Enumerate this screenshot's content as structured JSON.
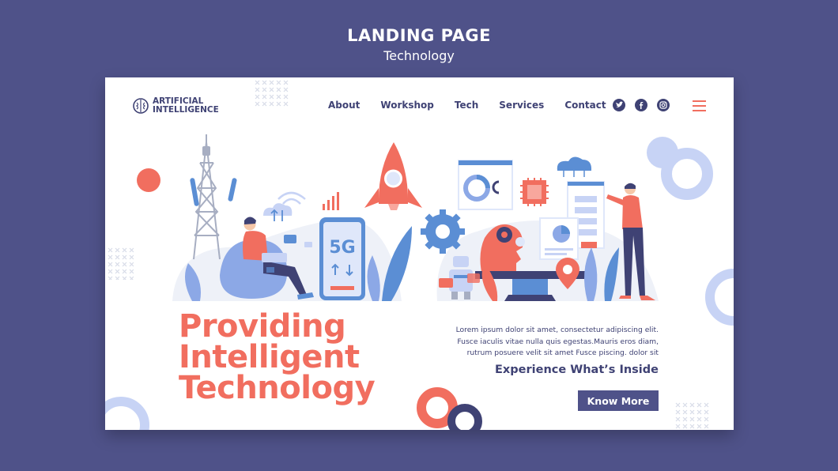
{
  "banner": {
    "title": "LANDING PAGE",
    "subtitle": "Technology"
  },
  "logo": {
    "line1": "ARTIFICIAL",
    "line2": "INTELLIGENCE",
    "icon": "brain-icon"
  },
  "nav": {
    "items": [
      "About",
      "Workshop",
      "Tech",
      "Services",
      "Contact"
    ]
  },
  "social": [
    "twitter-icon",
    "facebook-icon",
    "instagram-icon"
  ],
  "hero": {
    "phone_label": "5G",
    "headline_lines": [
      "Providing",
      "Intelligent",
      "Technology"
    ],
    "description_lines": [
      "Lorem ipsum dolor sit amet, consectetur adipiscing elit.",
      "Fusce iaculis vitae nulla quis egestas.Mauris eros diam,",
      "rutrum posuere velit sit amet Fusce piscing. dolor sit"
    ],
    "cta_text": "Experience What’s Inside",
    "button_label": "Know More"
  },
  "colors": {
    "background": "#4f5289",
    "navy": "#3f4274",
    "coral": "#f16e5f",
    "light_blue": "#c7d3f5",
    "mid_blue": "#5b8ed4"
  }
}
